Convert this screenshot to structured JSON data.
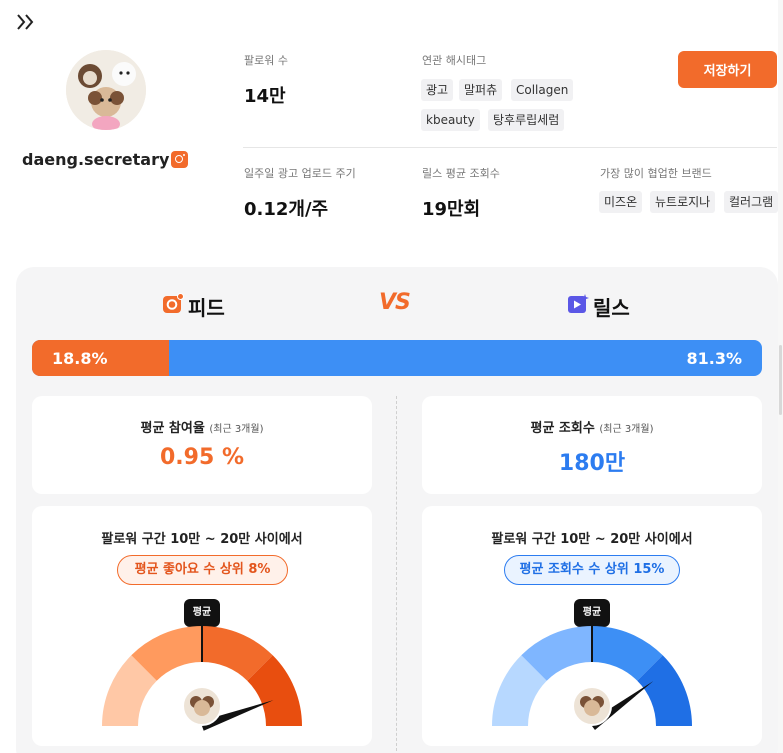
{
  "profile": {
    "username": "daeng.secretary"
  },
  "stats": {
    "followers_label": "팔로워 수",
    "followers_value": "14만",
    "hashtags_label": "연관 해시태그",
    "hashtags": [
      "광고",
      "말퍼츄",
      "Collagen",
      "kbeauty",
      "탕후루립세럼"
    ],
    "ad_cycle_label": "일주일 광고 업로드 주기",
    "ad_cycle_value": "0.12개/주",
    "reels_views_label": "릴스 평균 조회수",
    "reels_views_value": "19만회",
    "brands_label": "가장 많이 협업한 브랜드",
    "brands": [
      "미즈온",
      "뉴트로지나",
      "컬러그램"
    ]
  },
  "actions": {
    "save_label": "저장하기"
  },
  "compare": {
    "feed_title": "피드",
    "vs_label": "VS",
    "reels_title": "릴스",
    "feed_share": "18.8%",
    "reels_share": "81.3%",
    "feed_share_value": 18.8,
    "reels_share_value": 81.3
  },
  "feed": {
    "avg_title": "평균 참여율",
    "avg_sub": "(최근 3개월)",
    "avg_value": "0.95 %",
    "range_title": "팔로워 구간 10만 ~ 20만 사이에서",
    "rank_pill": "평균 좋아요 수 상위 8%",
    "bubble_label": "평균",
    "gauge_percentile": 8,
    "accent": "#f26b2b"
  },
  "reels": {
    "avg_title": "평균 조회수",
    "avg_sub": "(최근 3개월)",
    "avg_value": "180만",
    "range_title": "팔로워 구간 10만 ~ 20만 사이에서",
    "rank_pill": "평균 조회수 수 상위 15%",
    "bubble_label": "평균",
    "gauge_percentile": 15,
    "accent": "#2c7cf0"
  },
  "icons": {
    "expand": "double-chevron-right-icon",
    "instagram": "instagram-icon",
    "feed": "camera-icon",
    "reels": "video-play-icon"
  }
}
